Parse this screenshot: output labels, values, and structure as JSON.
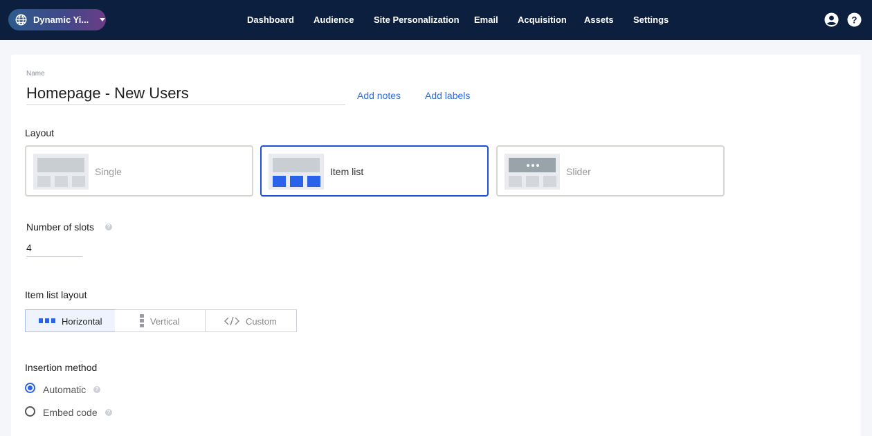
{
  "header": {
    "site_selector": "Dynamic Yi...",
    "nav": [
      "Dashboard",
      "Audience",
      "Site Personalization",
      "Email",
      "Acquisition",
      "Assets",
      "Settings"
    ],
    "icons": [
      "account-icon",
      "help-icon"
    ]
  },
  "form": {
    "name_label": "Name",
    "name_value": "Homepage - New Users",
    "add_notes": "Add notes",
    "add_labels": "Add labels",
    "layout_title": "Layout",
    "layouts": [
      {
        "label": "Single",
        "selected": false
      },
      {
        "label": "Item list",
        "selected": true
      },
      {
        "label": "Slider",
        "selected": false
      }
    ],
    "slots_label": "Number of slots",
    "slots_value": "4",
    "item_list_layout_title": "Item list layout",
    "item_list_layouts": [
      {
        "label": "Horizontal",
        "selected": true
      },
      {
        "label": "Vertical",
        "selected": false
      },
      {
        "label": "Custom",
        "selected": false
      }
    ],
    "insertion_title": "Insertion method",
    "insertion_options": [
      {
        "label": "Automatic",
        "selected": true
      },
      {
        "label": "Embed code",
        "selected": false
      }
    ]
  },
  "colors": {
    "header_bg": "#0c1f3f",
    "accent": "#2a62ea",
    "link": "#2a6ee0"
  }
}
